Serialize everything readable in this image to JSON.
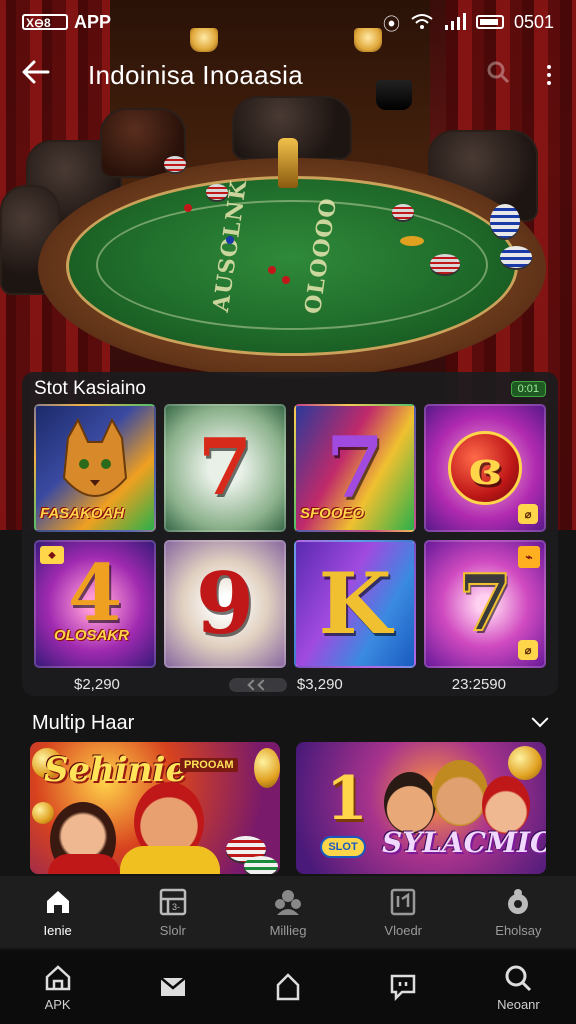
{
  "status_bar": {
    "left_text": "APP",
    "time": "0501"
  },
  "header": {
    "title": "Indoinisa Inoaasia"
  },
  "scene": {
    "felt_text_left": "AUSOLNK",
    "felt_text_right": "OLOOOO"
  },
  "slot_section": {
    "title": "Stot Kasiaino",
    "badge": "0:01",
    "tiles": [
      {
        "glyph": "",
        "label": "FASAKOAH"
      },
      {
        "glyph": "7",
        "label": ""
      },
      {
        "glyph": "7",
        "label": "SFOOEO"
      },
      {
        "glyph": "ɞ",
        "label": ""
      },
      {
        "glyph": "4",
        "label": "OLOSAKR"
      },
      {
        "glyph": "9",
        "label": ""
      },
      {
        "glyph": "K",
        "label": ""
      },
      {
        "glyph": "7",
        "label": ""
      }
    ],
    "jackpots": [
      "$2,290",
      "$3,290",
      "23:2590"
    ]
  },
  "multi_section": {
    "title": "Multip Haar",
    "banners": [
      {
        "title": "Sehinie",
        "subtitle": "PROOAM"
      },
      {
        "title": "SYLACMIOS",
        "badge": "SLOT"
      }
    ]
  },
  "tab_bar": {
    "items": [
      {
        "label": "Ienie"
      },
      {
        "label": "Slolr"
      },
      {
        "label": "Millieg"
      },
      {
        "label": "Vloedr"
      },
      {
        "label": "Eholsay"
      }
    ]
  },
  "nav_bar": {
    "items": [
      {
        "label": "APK"
      },
      {
        "label": ""
      },
      {
        "label": ""
      },
      {
        "label": ""
      },
      {
        "label": "Neoanr"
      }
    ]
  },
  "colors": {
    "accent_gold": "#ffd54a",
    "felt_green": "#1f6b2a",
    "panel_bg": "#1c1c1e",
    "badge_green": "#3fa83f"
  }
}
